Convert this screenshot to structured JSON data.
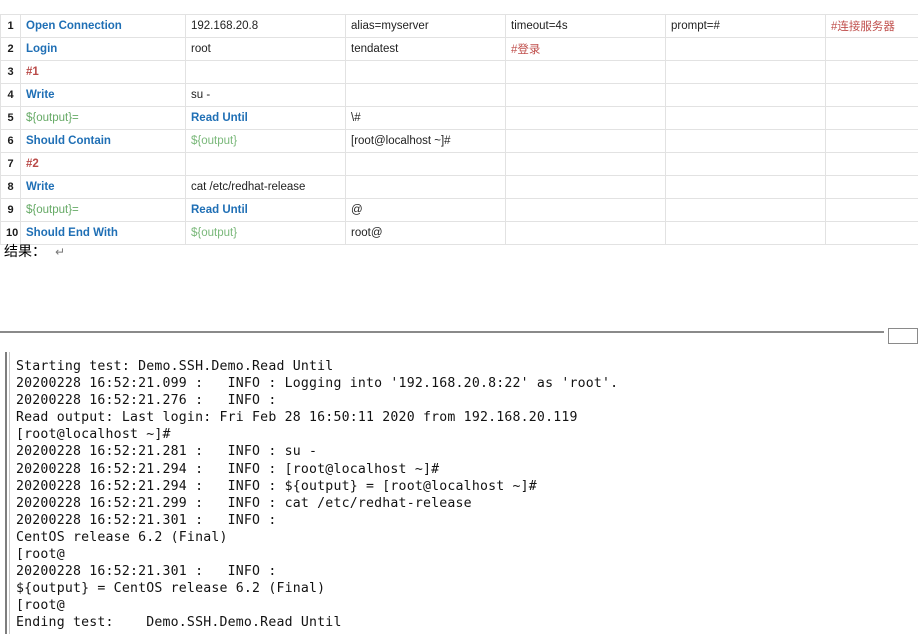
{
  "top_sliver": "· · · ·",
  "keyword_table": {
    "name": "robot-framework-keyword-table",
    "rows": [
      {
        "num": "1",
        "cells": [
          {
            "text": "Open Connection",
            "style": "kw"
          },
          {
            "text": "192.168.20.8",
            "style": "plain"
          },
          {
            "text": "alias=myserver",
            "style": "plain"
          },
          {
            "text": "timeout=4s",
            "style": "plain"
          },
          {
            "text": "prompt=#",
            "style": "plain"
          },
          {
            "text": "#连接服务器",
            "style": "cmtn"
          }
        ]
      },
      {
        "num": "2",
        "cells": [
          {
            "text": "Login",
            "style": "kw"
          },
          {
            "text": "root",
            "style": "plain"
          },
          {
            "text": "tendatest",
            "style": "plain"
          },
          {
            "text": "#登录",
            "style": "cmtn"
          },
          {
            "text": "",
            "style": "plain"
          },
          {
            "text": "",
            "style": "plain"
          }
        ]
      },
      {
        "num": "3",
        "cells": [
          {
            "text": "#1",
            "style": "cmt"
          },
          {
            "text": "",
            "style": "plain"
          },
          {
            "text": "",
            "style": "plain"
          },
          {
            "text": "",
            "style": "plain"
          },
          {
            "text": "",
            "style": "plain"
          },
          {
            "text": "",
            "style": "faint"
          }
        ]
      },
      {
        "num": "4",
        "cells": [
          {
            "text": "Write",
            "style": "kw"
          },
          {
            "text": "su -",
            "style": "plain"
          },
          {
            "text": "",
            "style": "grey"
          },
          {
            "text": "",
            "style": "grey"
          },
          {
            "text": "",
            "style": "grey"
          },
          {
            "text": "",
            "style": "grey"
          }
        ]
      },
      {
        "num": "5",
        "cells": [
          {
            "text": "${output}=",
            "style": "var"
          },
          {
            "text": "Read Until",
            "style": "kw"
          },
          {
            "text": "\\#",
            "style": "plain"
          },
          {
            "text": "",
            "style": "faint"
          },
          {
            "text": "",
            "style": "grey"
          },
          {
            "text": "",
            "style": "grey"
          }
        ]
      },
      {
        "num": "6",
        "cells": [
          {
            "text": "Should Contain",
            "style": "kw"
          },
          {
            "text": "${output}",
            "style": "varb"
          },
          {
            "text": "[root@localhost ~]#",
            "style": "plain"
          },
          {
            "text": "",
            "style": "faint"
          },
          {
            "text": "",
            "style": "faint"
          },
          {
            "text": "",
            "style": "faint"
          }
        ]
      },
      {
        "num": "7",
        "cells": [
          {
            "text": "#2",
            "style": "cmt"
          },
          {
            "text": "",
            "style": "plain"
          },
          {
            "text": "",
            "style": "plain"
          },
          {
            "text": "",
            "style": "plain"
          },
          {
            "text": "",
            "style": "plain"
          },
          {
            "text": "",
            "style": "faint"
          }
        ]
      },
      {
        "num": "8",
        "cells": [
          {
            "text": "Write",
            "style": "kw"
          },
          {
            "text": "cat /etc/redhat-release",
            "style": "plain"
          },
          {
            "text": "",
            "style": "grey"
          },
          {
            "text": "",
            "style": "grey"
          },
          {
            "text": "",
            "style": "grey"
          },
          {
            "text": "",
            "style": "grey"
          }
        ]
      },
      {
        "num": "9",
        "cells": [
          {
            "text": "${output}=",
            "style": "var"
          },
          {
            "text": "Read Until",
            "style": "kw"
          },
          {
            "text": "@",
            "style": "plain"
          },
          {
            "text": "",
            "style": "faint"
          },
          {
            "text": "",
            "style": "grey"
          },
          {
            "text": "",
            "style": "grey"
          }
        ]
      },
      {
        "num": "10",
        "cells": [
          {
            "text": "Should End With",
            "style": "kw"
          },
          {
            "text": "${output}",
            "style": "varb"
          },
          {
            "text": "root@",
            "style": "plain"
          },
          {
            "text": "",
            "style": "faint"
          },
          {
            "text": "",
            "style": "faint"
          },
          {
            "text": "",
            "style": "faint"
          }
        ]
      }
    ]
  },
  "result_label": {
    "text": "结果：",
    "pilcrow": "↵"
  },
  "console": {
    "name": "test-output-console",
    "lines": [
      "Starting test: Demo.SSH.Demo.Read Until",
      "20200228 16:52:21.099 :   INFO : Logging into '192.168.20.8:22' as 'root'.",
      "20200228 16:52:21.276 :   INFO :",
      "Read output: Last login: Fri Feb 28 16:50:11 2020 from 192.168.20.119",
      "[root@localhost ~]#",
      "20200228 16:52:21.281 :   INFO : su -",
      "20200228 16:52:21.294 :   INFO : [root@localhost ~]#",
      "20200228 16:52:21.294 :   INFO : ${output} = [root@localhost ~]#",
      "20200228 16:52:21.299 :   INFO : cat /etc/redhat-release",
      "20200228 16:52:21.301 :   INFO :",
      "CentOS release 6.2 (Final)",
      "[root@",
      "20200228 16:52:21.301 :   INFO :",
      "${output} = CentOS release 6.2 (Final)",
      "[root@",
      "Ending test:    Demo.SSH.Demo.Read Until"
    ]
  },
  "colors": {
    "keyword_blue": "#1f6fb5",
    "variable_green": "#66aa66",
    "comment_red": "#b94a48",
    "grey_cell": "#c3c3c3",
    "grid_line": "#e2e2e2"
  }
}
